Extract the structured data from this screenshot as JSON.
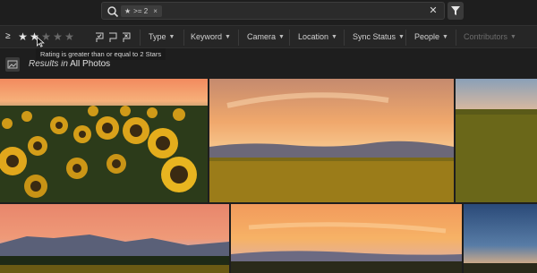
{
  "search": {
    "chip_text": ">= 2",
    "icons": {
      "search": "search-icon",
      "chip_star": "star-icon",
      "chip_remove": "close-icon",
      "clear": "close-icon",
      "filter": "filter-icon"
    }
  },
  "filterbar": {
    "rating_operator": "≥",
    "rating_value": 2,
    "rating_max": 5,
    "flag_icons": [
      "flag-picked-icon",
      "flag-unflagged-icon",
      "flag-rejected-icon"
    ],
    "dropdowns": [
      {
        "label": "Type"
      },
      {
        "label": "Keyword"
      },
      {
        "label": "Camera"
      },
      {
        "label": "Location"
      },
      {
        "label": "Sync Status"
      },
      {
        "label": "People"
      },
      {
        "label": "Contributors"
      }
    ]
  },
  "tooltip": {
    "text": "Rating is greater than or equal to 2 Stars"
  },
  "results": {
    "prefix": "Results in",
    "scope": "All Photos"
  },
  "photos": [
    {
      "subject": "sunflowers close-up at sunset"
    },
    {
      "subject": "sunflower field under orange sky"
    },
    {
      "subject": "sunflower field at dusk"
    },
    {
      "subject": "mountains silhouette at sunset over field"
    },
    {
      "subject": "orange sky over mountains"
    },
    {
      "subject": "blue dusk sky"
    }
  ],
  "colors": {
    "accent": "#e8e8e8",
    "background": "#1e1e1e",
    "bar": "#262626"
  }
}
